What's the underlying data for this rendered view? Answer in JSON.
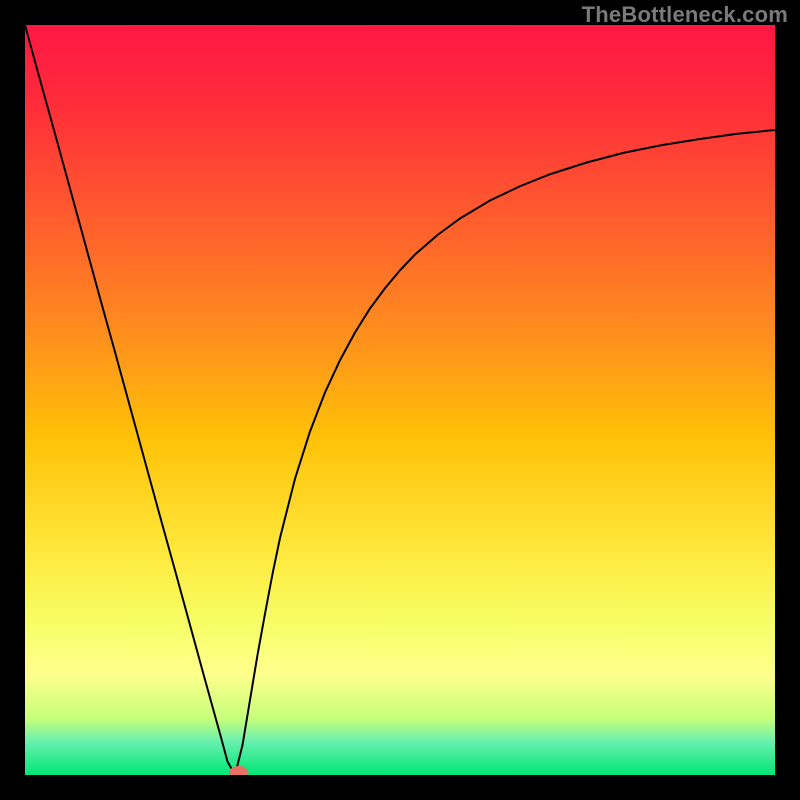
{
  "watermark": "TheBottleneck.com",
  "chart_data": {
    "type": "line",
    "title": "",
    "xlabel": "",
    "ylabel": "",
    "xlim": [
      0,
      100
    ],
    "ylim": [
      0,
      100
    ],
    "background_gradient_stops": [
      {
        "offset": 0.0,
        "color": "#ff1744"
      },
      {
        "offset": 0.1,
        "color": "#ff2b3a"
      },
      {
        "offset": 0.25,
        "color": "#ff5a2e"
      },
      {
        "offset": 0.4,
        "color": "#ff8a1f"
      },
      {
        "offset": 0.55,
        "color": "#ffc107"
      },
      {
        "offset": 0.7,
        "color": "#ffe83b"
      },
      {
        "offset": 0.8,
        "color": "#f6ff66"
      },
      {
        "offset": 0.865,
        "color": "#ffff8d"
      },
      {
        "offset": 0.925,
        "color": "#c6ff7a"
      },
      {
        "offset": 0.955,
        "color": "#69f0ae"
      },
      {
        "offset": 1.0,
        "color": "#00e676"
      }
    ],
    "series": [
      {
        "name": "bottleneck-curve",
        "color": "#000000",
        "width": 2,
        "x": [
          0.0,
          2,
          4,
          6,
          8,
          10,
          12,
          14,
          16,
          18,
          20,
          22,
          24,
          25,
          26,
          27,
          28,
          29,
          30,
          31,
          32,
          33,
          34,
          36,
          38,
          40,
          42,
          44,
          46,
          48,
          50,
          52,
          55,
          58,
          62,
          66,
          70,
          75,
          80,
          85,
          90,
          95,
          100
        ],
        "y": [
          100,
          92.7,
          85.5,
          78.2,
          70.9,
          63.6,
          56.4,
          49.1,
          41.8,
          34.5,
          27.3,
          20.0,
          12.7,
          9.1,
          5.5,
          1.8,
          0.0,
          4.0,
          10.0,
          16.0,
          21.5,
          26.8,
          31.6,
          39.5,
          45.8,
          51.0,
          55.3,
          59.0,
          62.2,
          64.9,
          67.3,
          69.4,
          72.0,
          74.2,
          76.6,
          78.5,
          80.1,
          81.7,
          83.0,
          84.0,
          84.8,
          85.5,
          86.0
        ]
      }
    ],
    "marker": {
      "x": 28.5,
      "y": 0.3,
      "rx": 1.3,
      "ry": 0.9,
      "color": "#e77062"
    }
  }
}
